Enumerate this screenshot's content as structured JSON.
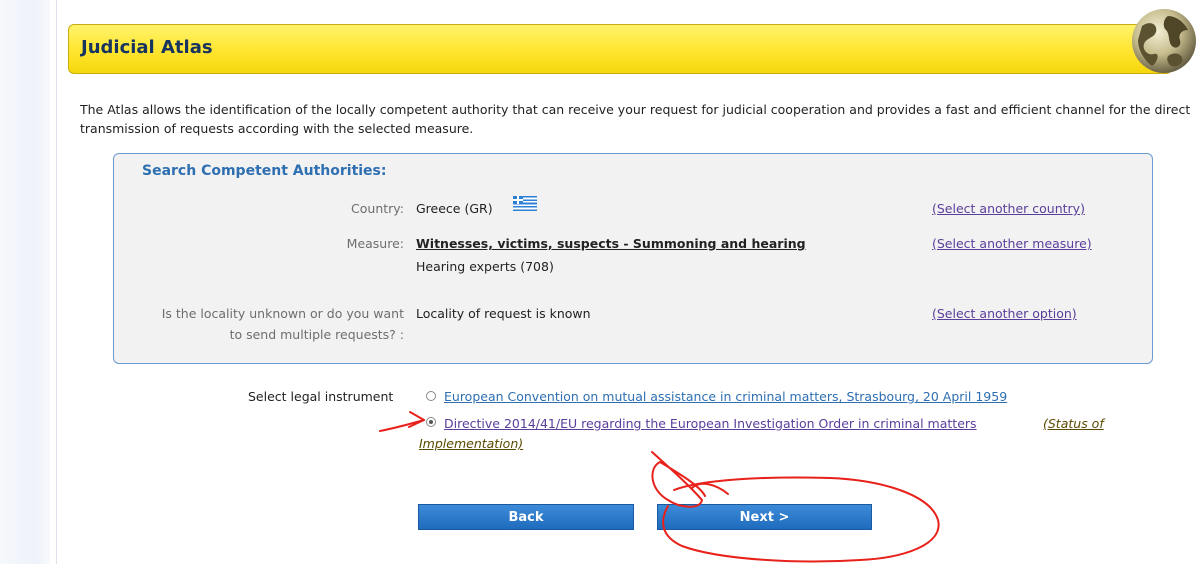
{
  "header": {
    "title": "Judicial Atlas"
  },
  "intro": "The Atlas allows the identification of the locally competent authority that can receive your request for judicial cooperation and provides a fast and efficient channel for the direct transmission of requests according with the selected measure.",
  "search": {
    "title": "Search Competent Authorities:",
    "country": {
      "label": "Country:",
      "value": "Greece (GR)",
      "link": "(Select another country)"
    },
    "measure": {
      "label": "Measure:",
      "value": "Witnesses, victims, suspects - Summoning and hearing",
      "sub": "Hearing experts (708)",
      "link": "(Select another measure)"
    },
    "locality": {
      "label_line1": "Is the locality unknown or do you want",
      "label_line2": "to send multiple requests? :",
      "value": "Locality of request is known",
      "link": "(Select another option)"
    }
  },
  "legal": {
    "label": "Select legal instrument",
    "options": [
      {
        "text": "European Convention on mutual assistance in criminal matters, Strasbourg, 20 April 1959",
        "selected": false
      },
      {
        "text": "Directive 2014/41/EU regarding the European Investigation Order in criminal matters",
        "selected": true
      }
    ],
    "status_line1": "(Status of",
    "status_line2": "Implementation)"
  },
  "buttons": {
    "back": "Back",
    "next": "Next >"
  },
  "colors": {
    "header_yellow": "#ffe52e",
    "link_blue": "#2e6fb2",
    "button_blue": "#1f6bbd",
    "annotation_red": "#e8211a"
  },
  "icons": {
    "globe": "globe-icon",
    "flag": "greece-flag-icon"
  }
}
